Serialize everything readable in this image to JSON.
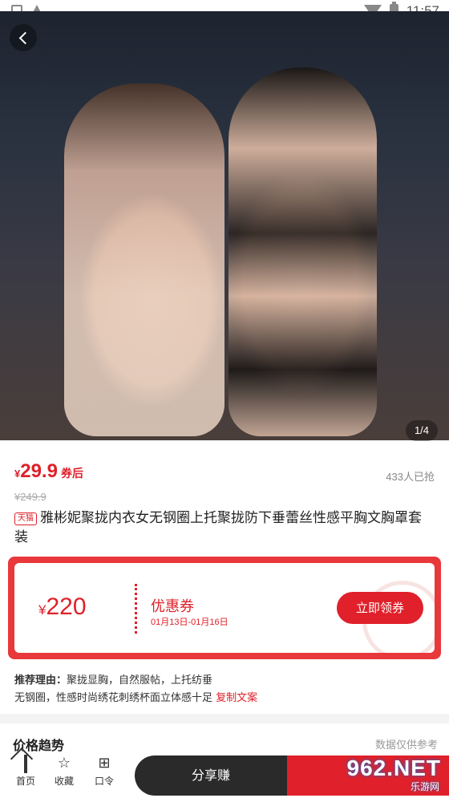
{
  "status_bar": {
    "time": "11:57"
  },
  "product": {
    "pager": "1/4",
    "price_currency": "¥",
    "price": "29.9",
    "price_tag": "券后",
    "sold": "433人已抢",
    "original_price": "¥249.9",
    "platform_badge": "天猫",
    "title": "雅彬妮聚拢内衣女无钢圈上托聚拢防下垂蕾丝性感平胸文胸罩套装"
  },
  "coupon": {
    "currency": "¥",
    "amount": "220",
    "name": "优惠券",
    "date_range": "01月13日-01月16日",
    "button": "立即领券"
  },
  "reason": {
    "label": "推荐理由：",
    "line1": "聚拢显胸，自然服帖，上托纺垂",
    "line2": "无钢圈，性感时尚绣花刺绣杯面立体感十足 ",
    "copy": "复制文案"
  },
  "trend": {
    "title": "价格趋势",
    "note": "数据仅供参考"
  },
  "bottom_bar": {
    "home": "首页",
    "favorite": "收藏",
    "code": "口令",
    "share": "分享赚"
  },
  "watermark": {
    "brand": "962.NET",
    "sub": "乐游网"
  }
}
